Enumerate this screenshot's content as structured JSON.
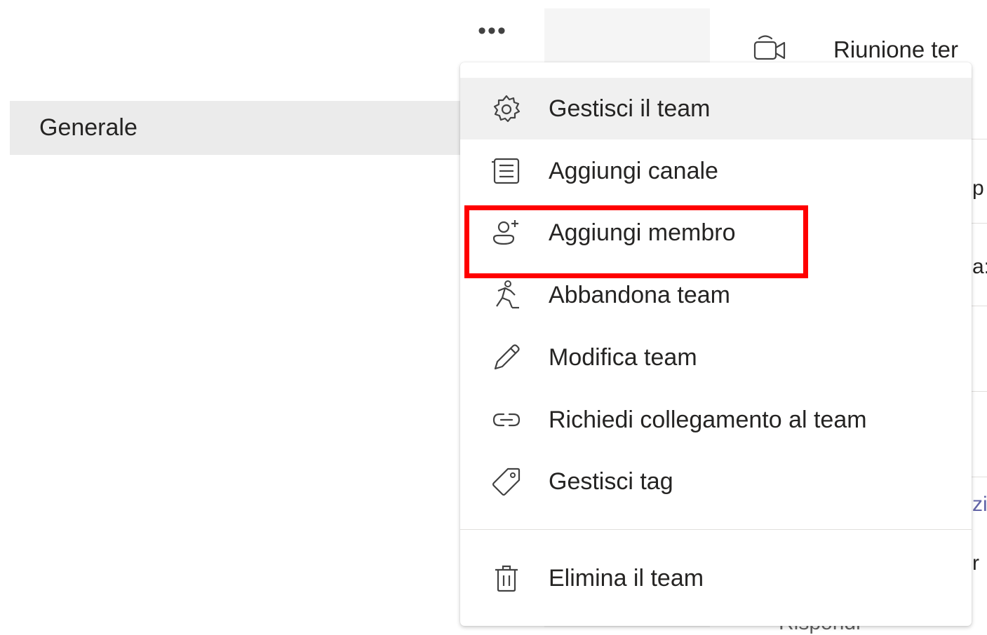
{
  "channels": {
    "selected_label": "Generale"
  },
  "header": {
    "more_label": "•••",
    "meeting_title": "Riunione ter"
  },
  "background_peek": [
    "p",
    "a:",
    "zi",
    "r",
    "Rispondi"
  ],
  "menu": {
    "items": [
      {
        "label": "Gestisci il team",
        "icon": "gear-icon"
      },
      {
        "label": "Aggiungi canale",
        "icon": "channel-list-icon"
      },
      {
        "label": "Aggiungi membro",
        "icon": "person-add-icon"
      },
      {
        "label": "Abbandona team",
        "icon": "leave-running-person-icon"
      },
      {
        "label": "Modifica team",
        "icon": "pencil-icon"
      },
      {
        "label": "Richiedi collegamento al team",
        "icon": "link-icon"
      },
      {
        "label": "Gestisci tag",
        "icon": "tag-icon"
      },
      {
        "label": "Elimina il team",
        "icon": "trash-icon"
      }
    ]
  },
  "colors": {
    "highlight": "#ff0000",
    "selected_row": "#ebebeb",
    "hover_row": "#f0f0f0",
    "text": "#252423"
  }
}
